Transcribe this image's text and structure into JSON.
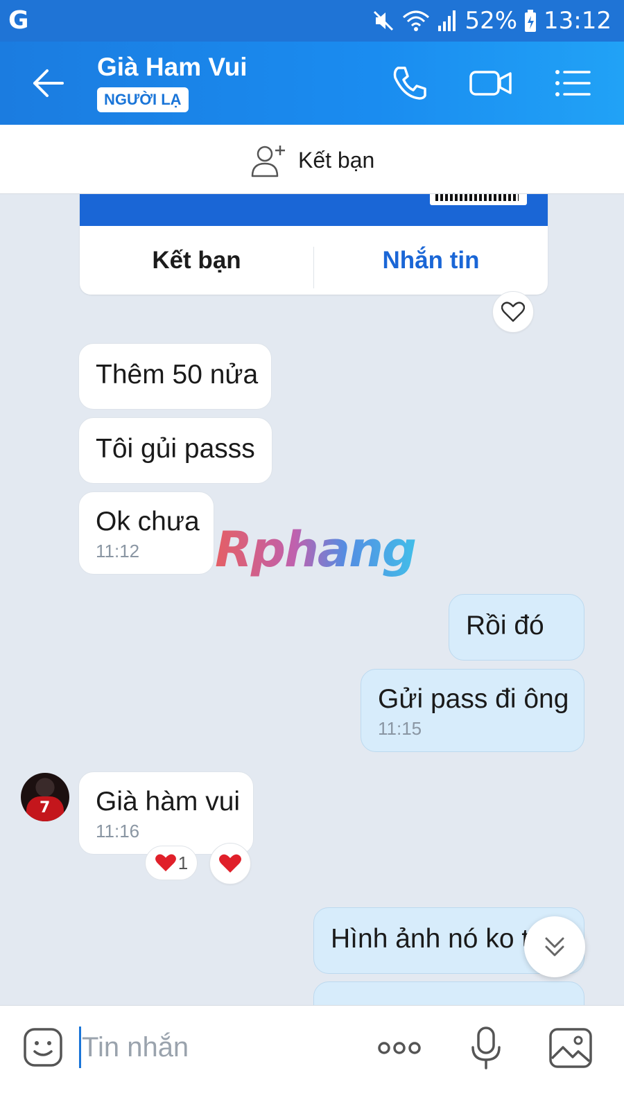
{
  "status_bar": {
    "left_icon": "G",
    "battery": "52%",
    "time": "13:12",
    "icons": [
      "mute-icon",
      "wifi-icon",
      "signal-icon",
      "battery-icon"
    ]
  },
  "header": {
    "title": "Già Ham Vui",
    "badge": "NGƯỜI LẠ",
    "icons": [
      "back-arrow-icon",
      "phone-icon",
      "video-call-icon",
      "menu-list-icon"
    ]
  },
  "add_friend_bar": {
    "label": "Kết bạn",
    "icon": "add-person-icon"
  },
  "profile_card": {
    "add_friend_label": "Kết bạn",
    "message_label": "Nhắn tin"
  },
  "messages": [
    {
      "direction": "in",
      "text": "Thêm 50 nửa",
      "time": ""
    },
    {
      "direction": "in",
      "text": "Tôi gủi passs",
      "time": ""
    },
    {
      "direction": "in",
      "text": "Ok chưa",
      "time": "11:12"
    },
    {
      "direction": "out",
      "text": "Rồi đó",
      "time": ""
    },
    {
      "direction": "out",
      "text": "Gửi pass đi ông",
      "time": "11:15"
    },
    {
      "direction": "in",
      "text": "Già hàm vui",
      "time": "11:16"
    },
    {
      "direction": "out",
      "text": "Hình ảnh nó ko t",
      "time": ""
    }
  ],
  "reactions": {
    "heart_count": "1"
  },
  "watermark": "Rphang",
  "composer": {
    "placeholder": "Tin nhắn",
    "icons": [
      "emoji-icon",
      "more-dots-icon",
      "microphone-icon",
      "image-icon"
    ]
  },
  "colors": {
    "header_blue": "#1a8cf0",
    "accent_blue": "#1a66d6",
    "outgoing_bubble": "#d7ecfb",
    "chat_bg": "#e3e9f1",
    "heart_red": "#e0202a"
  }
}
